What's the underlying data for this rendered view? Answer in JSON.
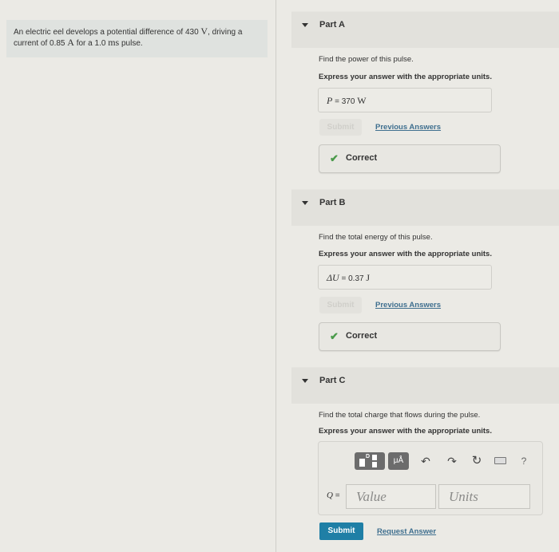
{
  "problem": {
    "text_1": "An electric eel develops a potential difference of 430",
    "unit_1": "V",
    "text_2": ", driving a current of 0.85",
    "unit_2": "A",
    "text_3": "for a 1.0",
    "unit_3": "ms",
    "text_4": "pulse."
  },
  "parts": [
    {
      "title": "Part A",
      "question": "Find the power of this pulse.",
      "instruction": "Express your answer with the appropriate units.",
      "answer_var": "P",
      "answer_eq": "=",
      "answer_value": "370",
      "answer_unit": "W",
      "submit_label": "Submit",
      "link_label": "Previous Answers",
      "status_icon": "check-icon",
      "status_label": "Correct"
    },
    {
      "title": "Part B",
      "question": "Find the total energy of this pulse.",
      "instruction": "Express your answer with the appropriate units.",
      "answer_var": "ΔU",
      "answer_eq": "=",
      "answer_value": "0.37",
      "answer_unit": "J",
      "submit_label": "Submit",
      "link_label": "Previous Answers",
      "status_icon": "check-icon",
      "status_label": "Correct"
    },
    {
      "title": "Part C",
      "question": "Find the total charge that flows during the pulse.",
      "instruction": "Express your answer with the appropriate units.",
      "answer_var": "Q",
      "answer_eq": "=",
      "value_placeholder": "Value",
      "units_placeholder": "Units",
      "submit_label": "Submit",
      "link_label": "Request Answer",
      "toolbar": {
        "templates_icon": "templates-icon",
        "templates_glyph": "D",
        "units_label": "μÅ",
        "undo_glyph": "↶",
        "redo_glyph": "↷",
        "reset_glyph": "↻",
        "keyboard_icon": "keyboard-icon",
        "help_glyph": "?"
      }
    }
  ],
  "colors": {
    "submit_active": "#1f7fa6",
    "link": "#3f6f8f",
    "correct_check": "#4a9a4a"
  }
}
